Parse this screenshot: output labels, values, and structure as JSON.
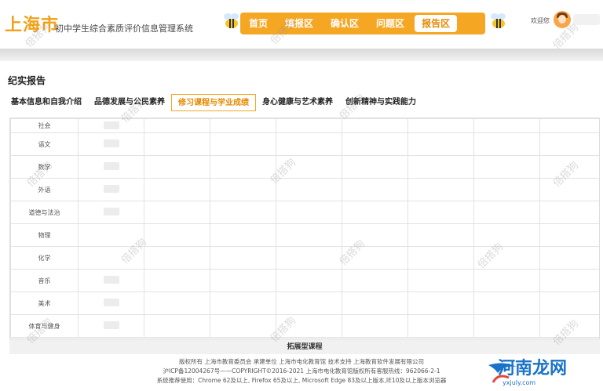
{
  "header": {
    "logo": "上海市",
    "subtitle": "初中学生综合素质评价信息管理系统",
    "nav": [
      {
        "label": "首页",
        "active": false
      },
      {
        "label": "填报区",
        "active": false
      },
      {
        "label": "确认区",
        "active": false
      },
      {
        "label": "问题区",
        "active": false
      },
      {
        "label": "报告区",
        "active": true
      }
    ],
    "welcome": "欢迎您"
  },
  "section": {
    "title": "纪实报告",
    "tabs": [
      {
        "label": "基本信息和自我介绍",
        "active": false
      },
      {
        "label": "品德发展与公民素养",
        "active": false
      },
      {
        "label": "修习课程与学业成绩",
        "active": true
      },
      {
        "label": "身心健康与艺术素养",
        "active": false
      },
      {
        "label": "创新精神与实践能力",
        "active": false
      }
    ]
  },
  "table": {
    "subjects": [
      "社会",
      "语文",
      "数学",
      "外语",
      "道德与法治",
      "物理",
      "化学",
      "音乐",
      "美术",
      "体育与健身"
    ],
    "extension_row": "拓展型课程"
  },
  "footer": {
    "line1": "版权所有 上海市教育委员会   承建单位 上海市电化教育馆   技术支持 上海教育软件发展有限公司",
    "line2": "沪ICP备12004267号——COPYRIGHT©2016-2021 上海市电化教育馆版权所有客服热线：962066-2-1",
    "line3": "系统推荐使用：Chrome 62及以上, Firefox 65及以上, Microsoft Edge 83及以上版本,IE10及以上版本浏览器"
  },
  "watermark": "倍搭狗",
  "brand": {
    "name": "河南龙网",
    "url": "yxjuly.com"
  },
  "colors": {
    "accent": "#f5a623",
    "logo": "#f0a21a",
    "brand": "#1a73c9"
  }
}
